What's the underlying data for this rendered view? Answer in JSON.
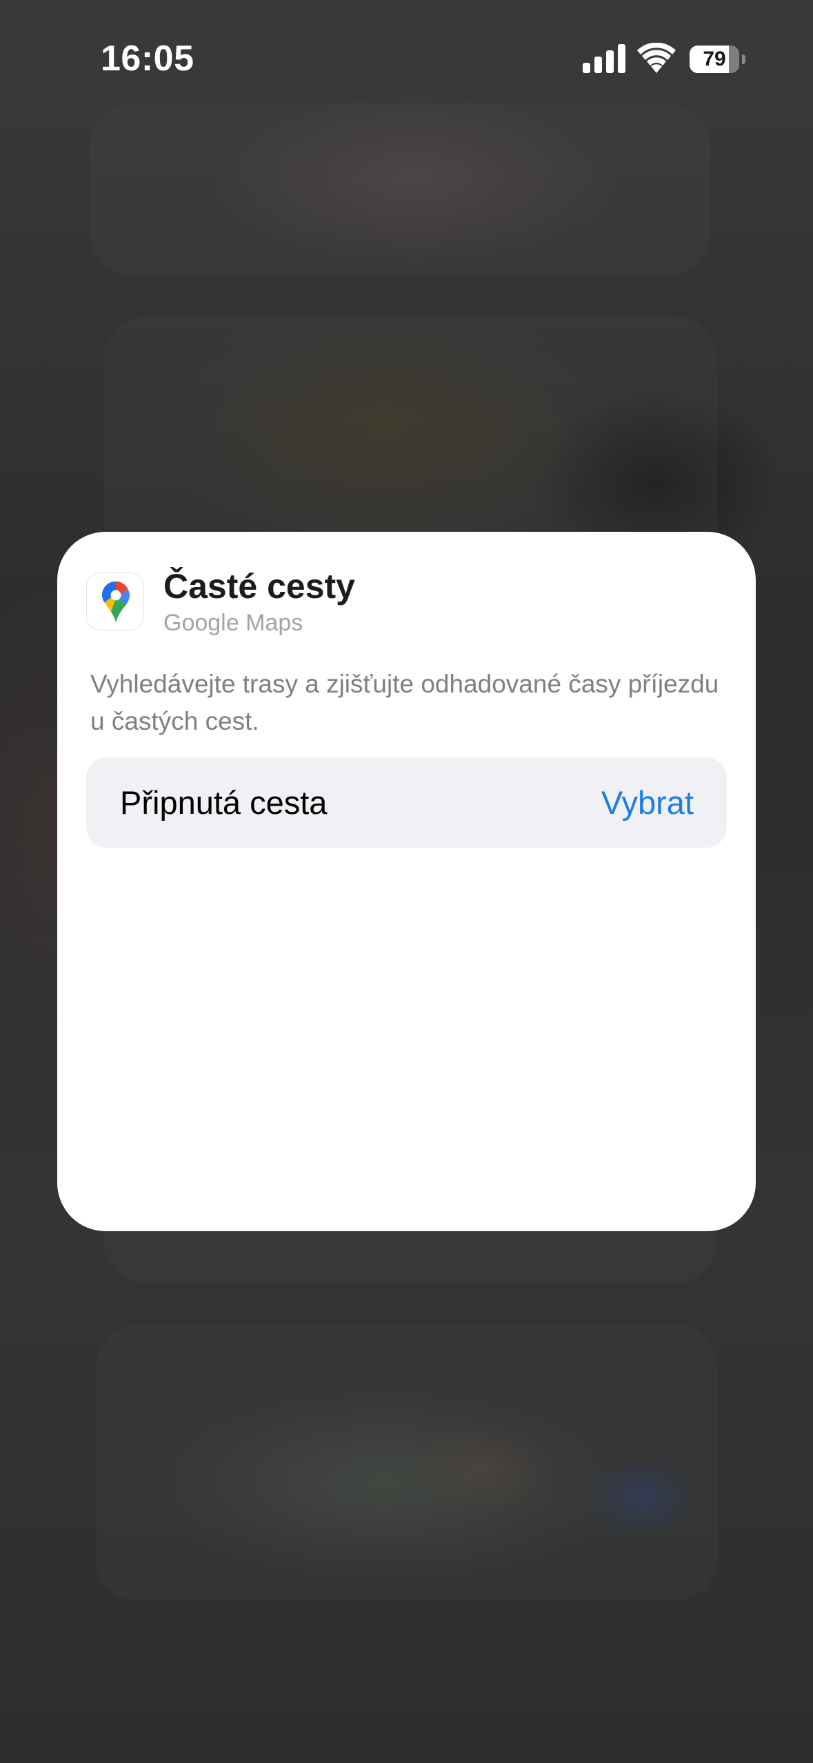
{
  "status_bar": {
    "time": "16:05",
    "battery_level": "79",
    "battery_fraction": 0.79,
    "icons": [
      "signal-icon",
      "wifi-icon",
      "battery-icon"
    ]
  },
  "widget": {
    "title": "Časté cesty",
    "app_name": "Google Maps",
    "app_icon": "google-maps-pin-icon",
    "description": "Vyhledávejte trasy a zjišťujte odhadované časy příjezdu u častých cest.",
    "setting": {
      "label": "Připnutá cesta",
      "action": "Vybrat"
    }
  },
  "colors": {
    "accent": "#1a7ee6",
    "card_bg": "#ffffff",
    "row_bg": "#f1f1f5"
  }
}
